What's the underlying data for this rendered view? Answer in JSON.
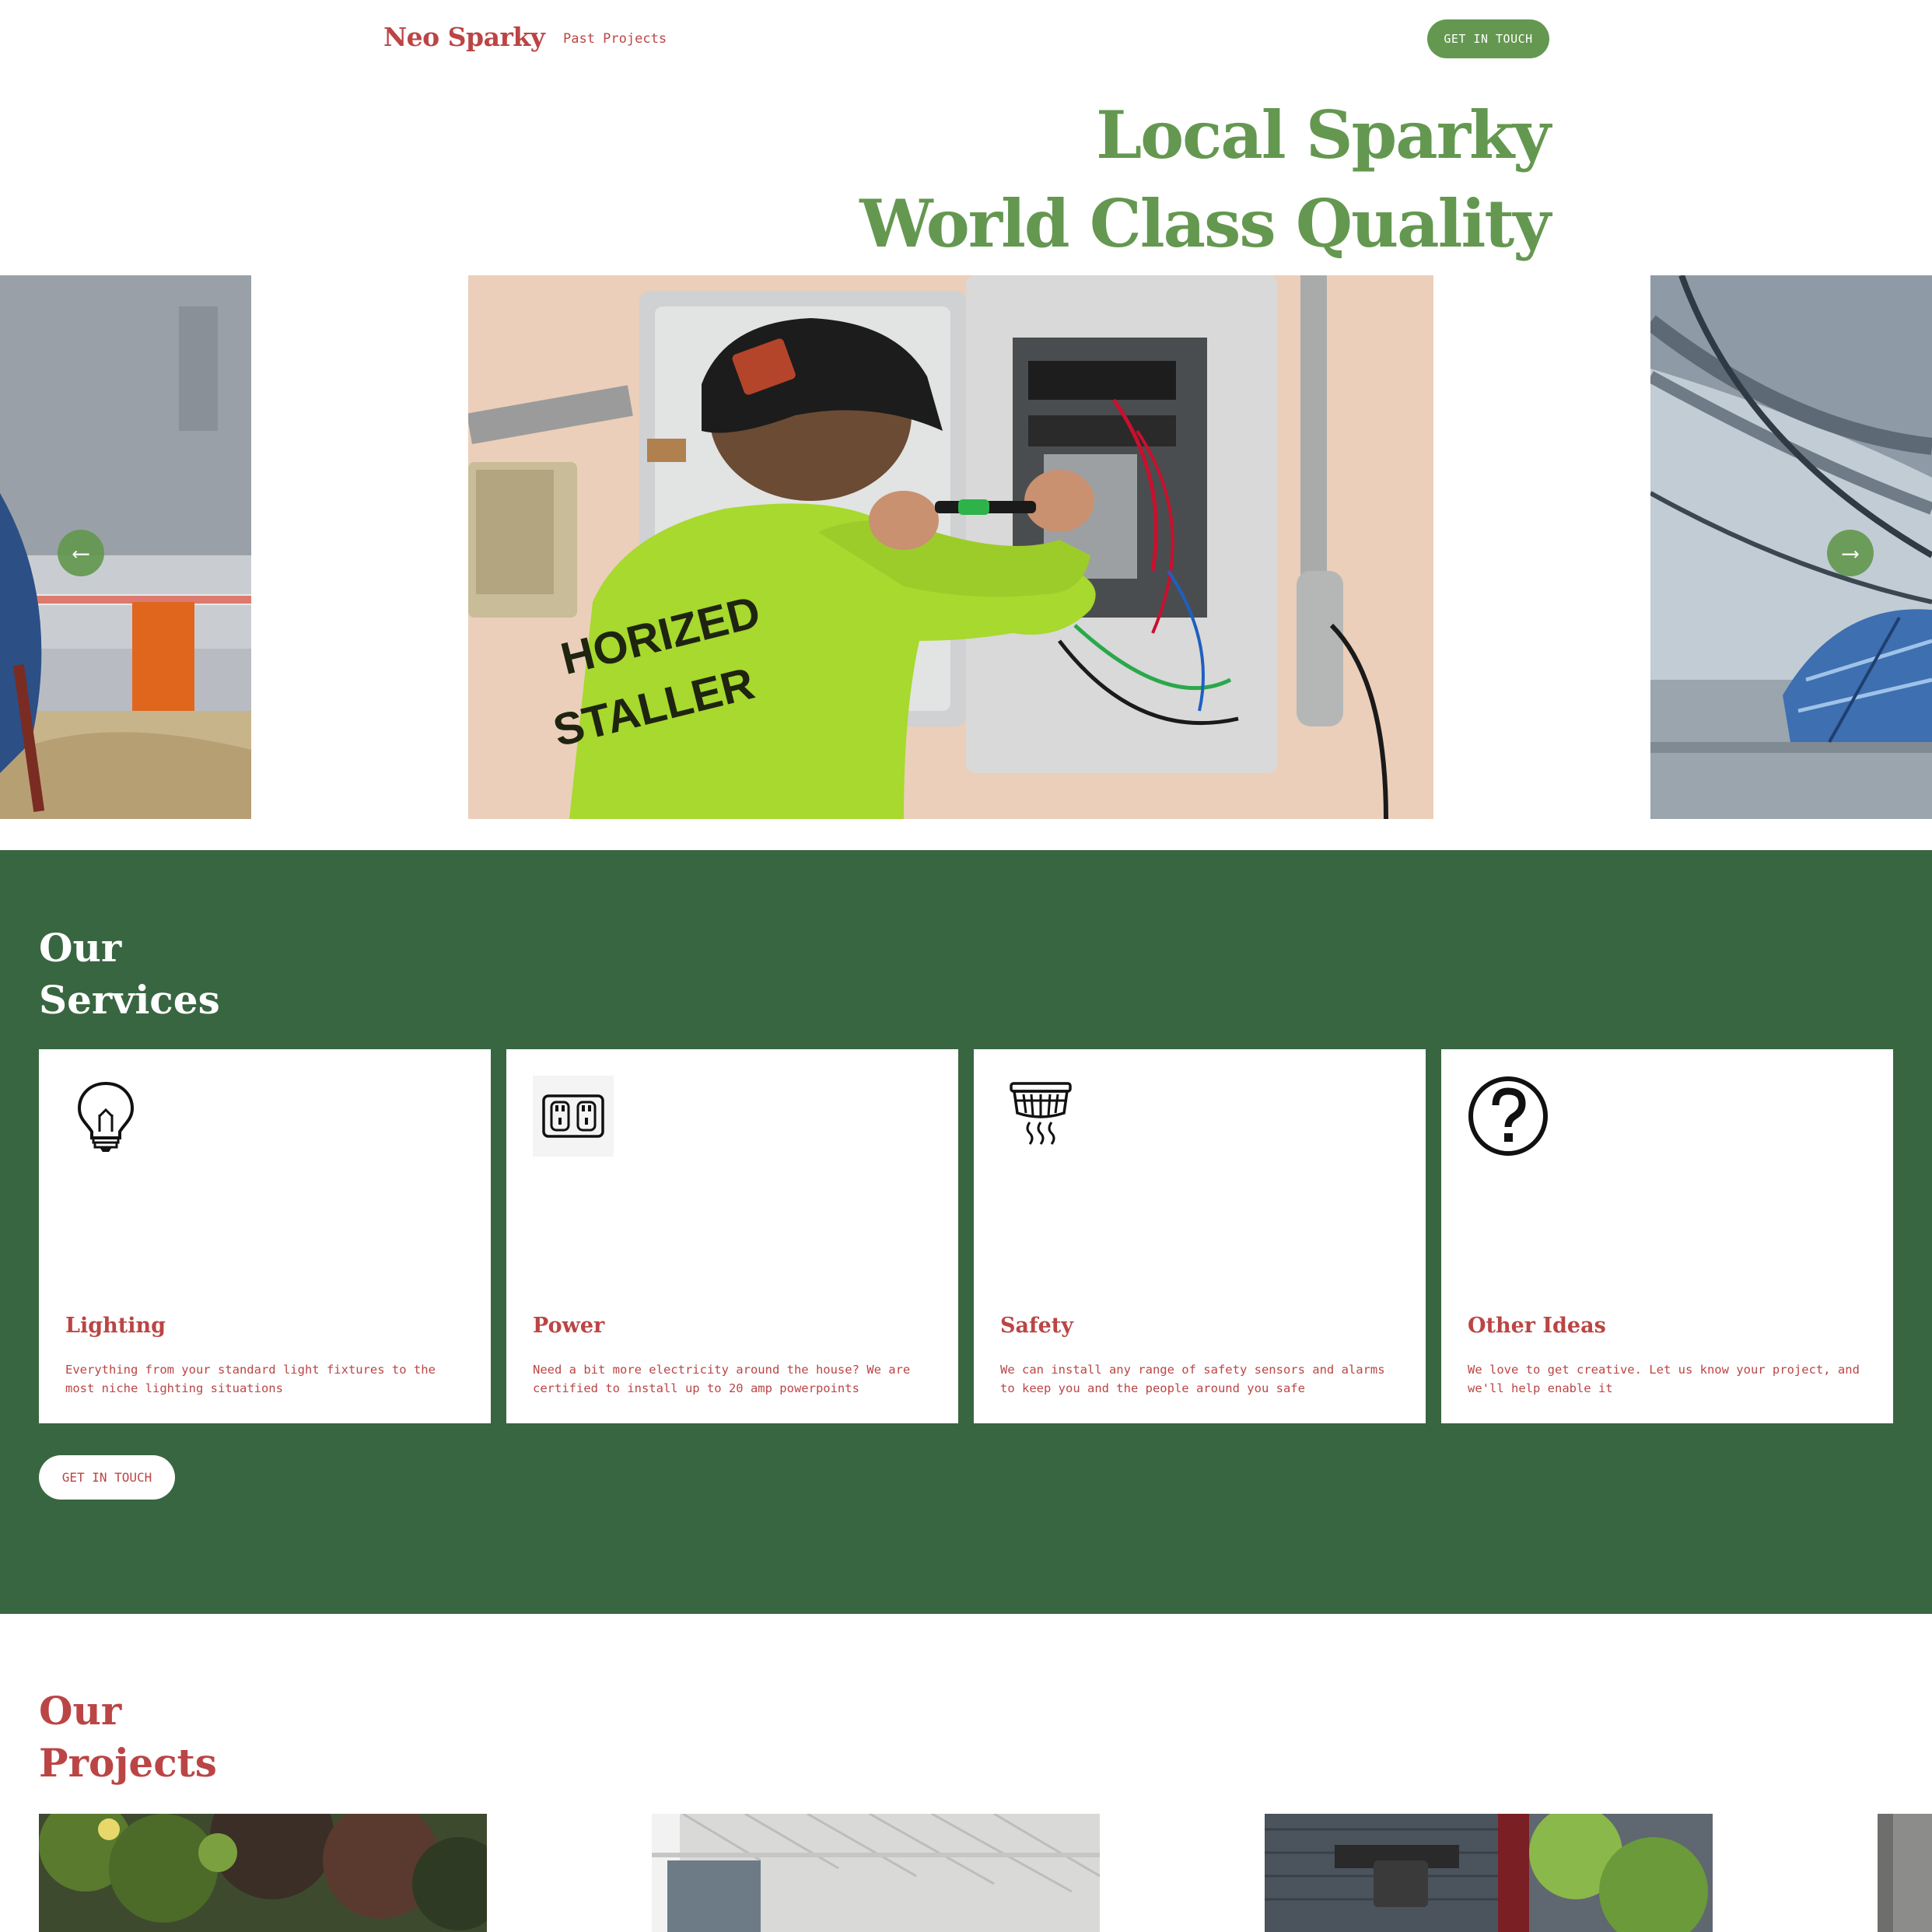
{
  "header": {
    "brand": "Neo Sparky",
    "nav": [
      {
        "label": "Past Projects"
      }
    ],
    "cta_label": "GET IN TOUCH"
  },
  "hero": {
    "line1": "Local Sparky",
    "line2": "World Class Quality"
  },
  "carousel": {
    "prev_icon": "arrow-left-icon",
    "next_icon": "arrow-right-icon",
    "prev_glyph": "⟵",
    "next_glyph": "⟶",
    "shirt_text": [
      "HORIZED",
      "STALLER"
    ]
  },
  "services": {
    "title_line1": "Our",
    "title_line2": "Services",
    "items": [
      {
        "title": "Lighting",
        "description": "Everything from your standard light fixtures to the most niche lighting situations",
        "icon": "lightbulb-icon"
      },
      {
        "title": "Power",
        "description": "Need a bit more electricity around the house? We are certified to install up to 20 amp powerpoints",
        "icon": "power-outlet-icon"
      },
      {
        "title": "Safety",
        "description": "We can install any range of safety sensors and alarms to keep you and the people around you safe",
        "icon": "smoke-detector-icon"
      },
      {
        "title": "Other Ideas",
        "description": "We love to get creative. Let us know your project, and we'll help enable it",
        "icon": "question-mark-icon"
      }
    ],
    "cta_label": "GET IN TOUCH"
  },
  "projects": {
    "title_line1": "Our",
    "title_line2": "Projects"
  },
  "colors": {
    "brand_red": "#bb4545",
    "accent_green": "#649850",
    "section_green": "#386641",
    "white": "#ffffff"
  }
}
